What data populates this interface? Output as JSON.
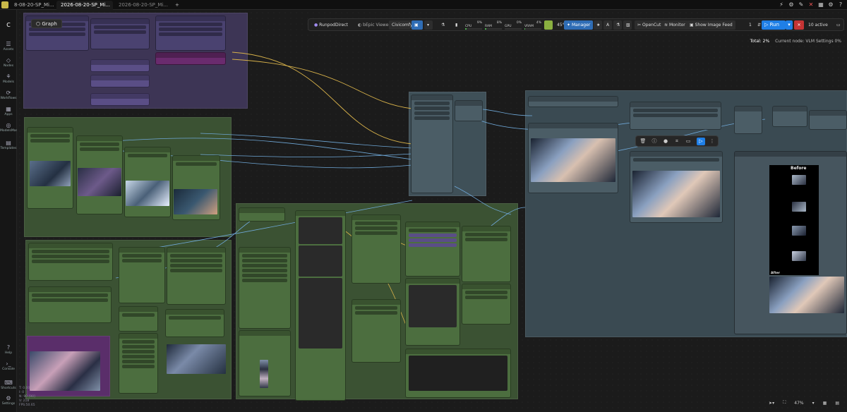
{
  "tabs": [
    {
      "label": "8-08-20-SP_Mi..."
    },
    {
      "label": "2026-08-20-SP_Mi...",
      "modified": "●"
    },
    {
      "label": "2026-08-20-SP_Mi..."
    }
  ],
  "new_tab": "+",
  "window_icons": [
    "⚡",
    "⚙",
    "✎",
    "✕",
    "▦",
    "⚙",
    "?"
  ],
  "sidebar": [
    {
      "icon": "☰",
      "label": "Assets"
    },
    {
      "icon": "◇",
      "label": "Nodes"
    },
    {
      "icon": "⚘",
      "label": "Models"
    },
    {
      "icon": "⟳",
      "label": "Workflows"
    },
    {
      "icon": "▦",
      "label": "Apps"
    },
    {
      "icon": "◎",
      "label": "ModelsMan"
    },
    {
      "icon": "▤",
      "label": "Templates"
    }
  ],
  "sidebar_bottom": [
    {
      "icon": "?",
      "label": "Help"
    },
    {
      "icon": "›_",
      "label": "Console"
    },
    {
      "icon": "⌨",
      "label": "Shortcuts"
    },
    {
      "icon": "⚙",
      "label": "Settings"
    }
  ],
  "graph_button": "Graph",
  "toolbar": {
    "runpod": "RunpodDirect",
    "viewer": "bEpic Viewer",
    "civitai": "Civicomfy",
    "cpu_label": "CPU",
    "cpu_value": "9%",
    "ram_label": "RAM",
    "ram_value": "8%",
    "gpu_label": "GPU",
    "gpu_value": "0%",
    "vram_label": "VRAM",
    "vram_value": "4%",
    "temp_value": "45°",
    "manager": "Manager",
    "opencut": "OpenCut",
    "monitor": "Monitor",
    "image_feed": "Show Image Feed",
    "queue_count": "1",
    "run": "Run",
    "active": "10 active"
  },
  "meters": {
    "cpu": 0.09,
    "ram": 0.08,
    "gpu": 0.0,
    "vram": 0.04
  },
  "status": {
    "total_label": "Total:",
    "total_value": "2%",
    "current_node": "Current node: VLM Settings 0%"
  },
  "canvas_stats": [
    "T: 0.00",
    "I: 0",
    "N: 90 [90]",
    "V: 218",
    "FPS:50.65"
  ],
  "zoom": "47%",
  "before_label": "Before",
  "after_label": "After",
  "colors": {
    "purple_group": "#3d3555",
    "green_group": "#3b5233",
    "teal_group": "#3a4a52",
    "node_green": "#4c6e3f",
    "node_purple": "#5a4e86",
    "wire_blue": "#6fa8d8",
    "wire_yellow": "#d8b24a",
    "accent": "#1f7fe6"
  }
}
